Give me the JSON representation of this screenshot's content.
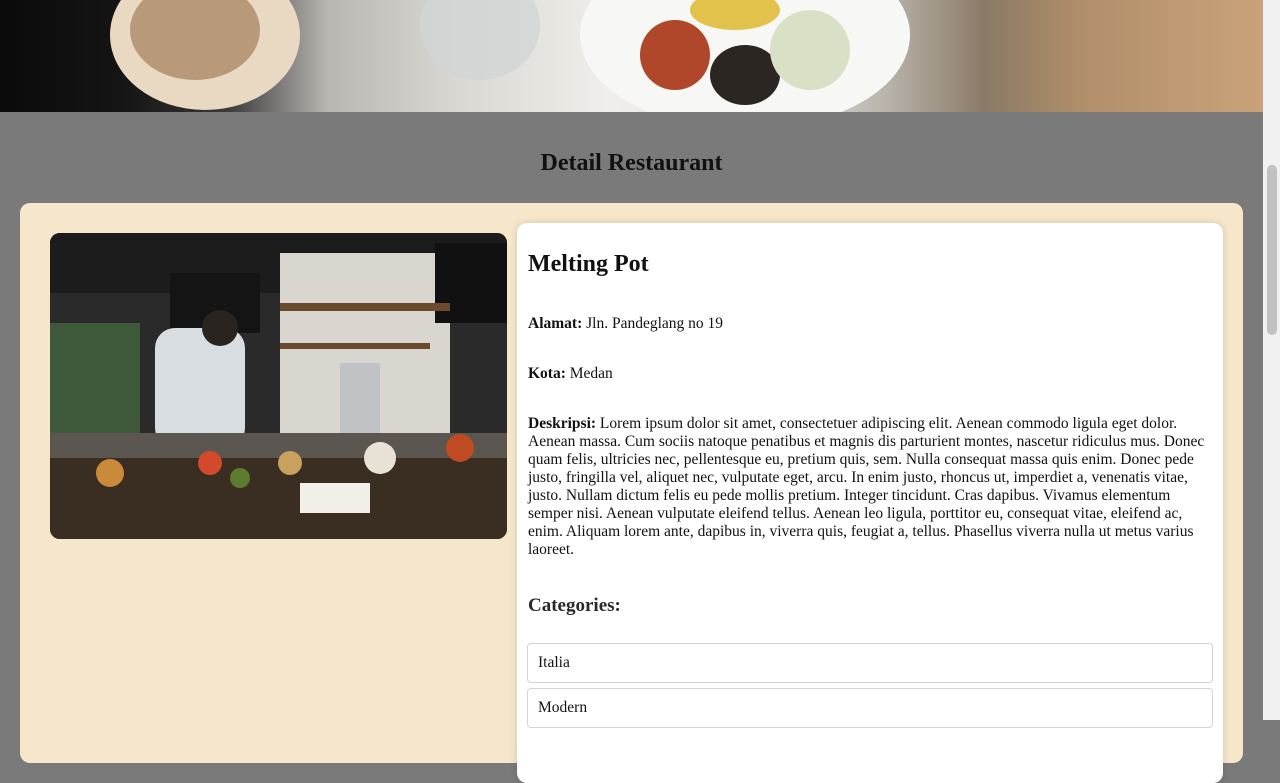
{
  "page": {
    "title": "Detail Restaurant"
  },
  "restaurant": {
    "name": "Melting Pot",
    "address_label": "Alamat:",
    "address": "Jln. Pandeglang no 19",
    "city_label": "Kota:",
    "city": "Medan",
    "description_label": "Deskripsi:",
    "description": "Lorem ipsum dolor sit amet, consectetuer adipiscing elit. Aenean commodo ligula eget dolor. Aenean massa. Cum sociis natoque penatibus et magnis dis parturient montes, nascetur ridiculus mus. Donec quam felis, ultricies nec, pellentesque eu, pretium quis, sem. Nulla consequat massa quis enim. Donec pede justo, fringilla vel, aliquet nec, vulputate eget, arcu. In enim justo, rhoncus ut, imperdiet a, venenatis vitae, justo. Nullam dictum felis eu pede mollis pretium. Integer tincidunt. Cras dapibus. Vivamus elementum semper nisi. Aenean vulputate eleifend tellus. Aenean leo ligula, porttitor eu, consequat vitae, eleifend ac, enim. Aliquam lorem ante, dapibus in, viverra quis, feugiat a, tellus. Phasellus viverra nulla ut metus varius laoreet."
  },
  "categories": {
    "heading": "Categories:",
    "items": [
      "Italia",
      "Modern"
    ]
  },
  "colors": {
    "backdrop": "#7a7a7a",
    "card": "#f6e7cb",
    "panel": "#ffffff"
  }
}
